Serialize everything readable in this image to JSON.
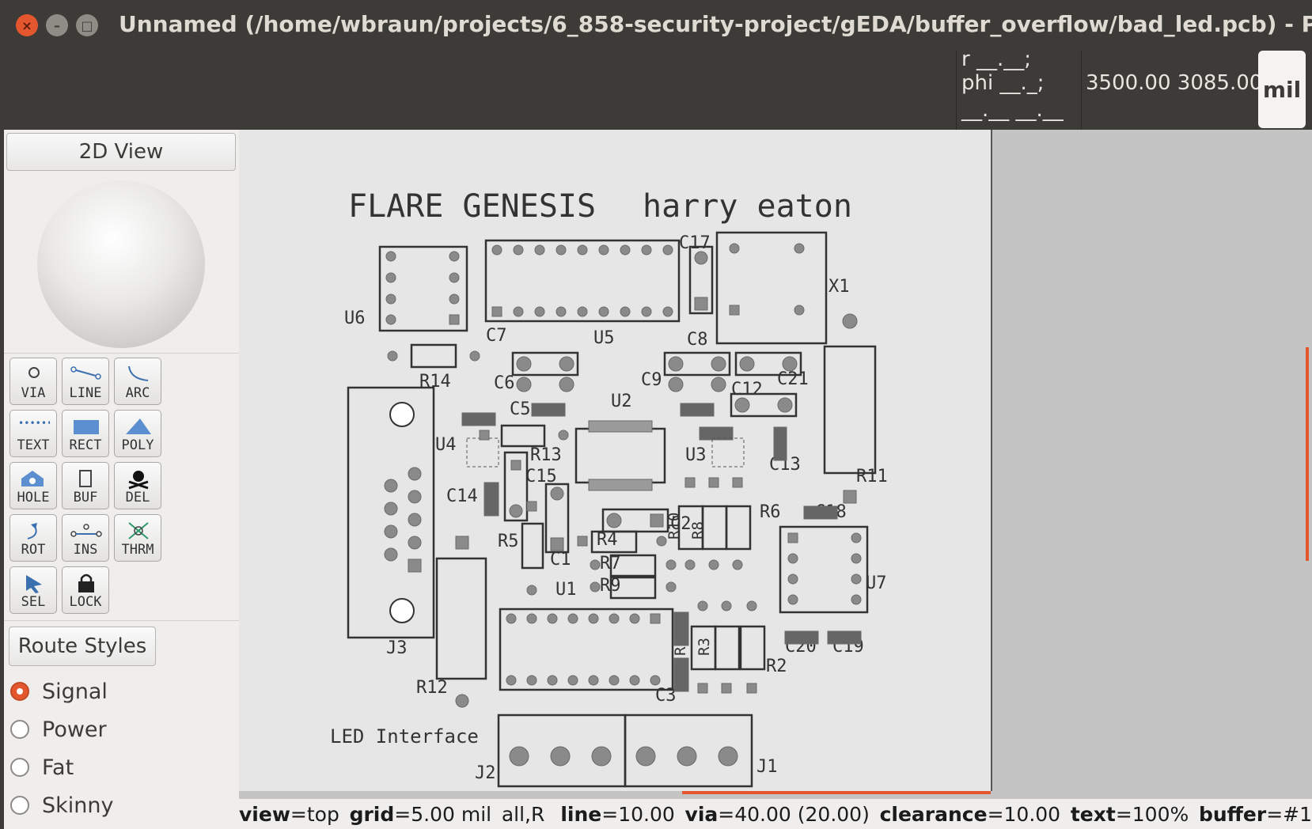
{
  "window": {
    "title": "Unnamed (/home/wbraun/projects/6_858-security-project/gEDA/buffer_overflow/bad_led.pcb) - PCB",
    "close_glyph": "×",
    "min_glyph": "–",
    "max_glyph": "□"
  },
  "coords": {
    "rel_r": "r __.__;",
    "rel_phi": "phi __._;",
    "rel_extra": "__.__ __.__",
    "absolute": "3500.00 3085.00",
    "unit": "mil"
  },
  "view_button": "2D View",
  "tools": [
    {
      "id": "via",
      "label": "VIA",
      "icon": "via-icon"
    },
    {
      "id": "line",
      "label": "LINE",
      "icon": "line-icon"
    },
    {
      "id": "arc",
      "label": "ARC",
      "icon": "arc-icon"
    },
    {
      "id": "text",
      "label": "TEXT",
      "icon": "text-icon"
    },
    {
      "id": "rect",
      "label": "RECT",
      "icon": "rect-icon"
    },
    {
      "id": "poly",
      "label": "POLY",
      "icon": "poly-icon"
    },
    {
      "id": "hole",
      "label": "HOLE",
      "icon": "hole-icon"
    },
    {
      "id": "buf",
      "label": "BUF",
      "icon": "buffer-icon"
    },
    {
      "id": "del",
      "label": "DEL",
      "icon": "delete-icon"
    },
    {
      "id": "rot",
      "label": "ROT",
      "icon": "rotate-icon"
    },
    {
      "id": "ins",
      "label": "INS",
      "icon": "insert-icon"
    },
    {
      "id": "thrm",
      "label": "THRM",
      "icon": "thermal-icon"
    },
    {
      "id": "sel",
      "label": "SEL",
      "icon": "select-icon"
    },
    {
      "id": "lock",
      "label": "LOCK",
      "icon": "lock-icon"
    }
  ],
  "route_styles": {
    "button": "Route Styles",
    "options": [
      {
        "label": "Signal",
        "selected": true
      },
      {
        "label": "Power",
        "selected": false
      },
      {
        "label": "Fat",
        "selected": false
      },
      {
        "label": "Skinny",
        "selected": false
      }
    ]
  },
  "board": {
    "title": "FLARE GENESIS",
    "author": "harry eaton",
    "interface_label": "LED Interface",
    "refdes": [
      "U6",
      "C7",
      "U5",
      "C17",
      "X1",
      "R14",
      "C6",
      "C8",
      "C9",
      "C21",
      "C12",
      "C5",
      "U2",
      "U4",
      "R13",
      "C15",
      "U3",
      "C13",
      "C14",
      "R11",
      "R5",
      "C1",
      "C2",
      "R10",
      "R8",
      "R6",
      "C18",
      "R4",
      "R7",
      "R9",
      "U7",
      "U1",
      "J3",
      "C20",
      "C19",
      "R1",
      "R3",
      "R2",
      "R12",
      "C3",
      "J2",
      "J1"
    ]
  },
  "status": {
    "view_key": "view",
    "view_val": "top",
    "grid_key": "grid",
    "grid_val": "5.00 mil",
    "mode": "all,R",
    "line_key": "line",
    "line_val": "10.00",
    "via_key": "via",
    "via_val": "40.00 (20.00)",
    "clearance_key": "clearance",
    "clearance_val": "10.00",
    "text_key": "text",
    "text_val": "100%",
    "buffer_key": "buffer",
    "buffer_val": "#1"
  },
  "colors": {
    "accent": "#e4572e",
    "titlebar": "#3c3b37",
    "board": "#e6e6e6",
    "silk": "#333333",
    "pad": "#8c8c8c"
  }
}
